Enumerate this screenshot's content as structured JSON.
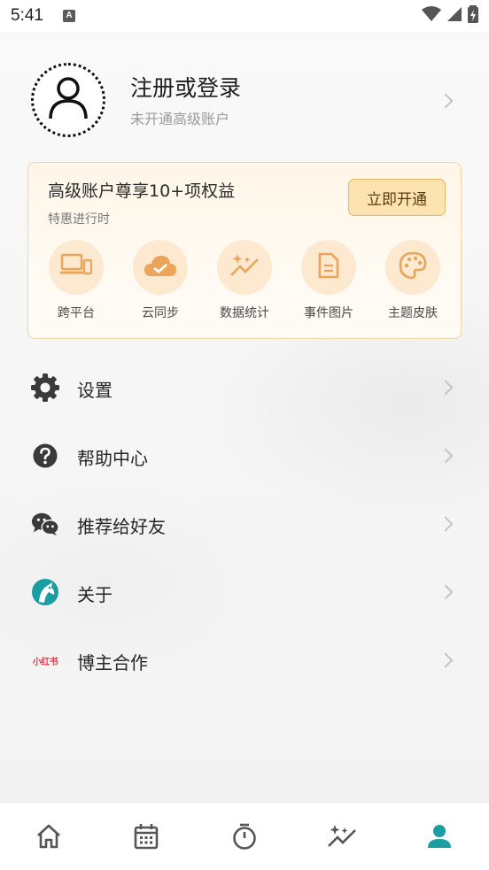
{
  "status_bar": {
    "time": "5:41",
    "indicator": "A"
  },
  "profile": {
    "name": "注册或登录",
    "subtitle": "未开通高级账户"
  },
  "premium": {
    "title": "高级账户尊享10+项权益",
    "subtitle": "特惠进行时",
    "button_label": "立即开通",
    "features": [
      {
        "label": "跨平台",
        "icon": "devices-icon"
      },
      {
        "label": "云同步",
        "icon": "cloud-check-icon"
      },
      {
        "label": "数据统计",
        "icon": "sparkle-chart-icon"
      },
      {
        "label": "事件图片",
        "icon": "document-icon"
      },
      {
        "label": "主题皮肤",
        "icon": "palette-icon"
      }
    ]
  },
  "menu": [
    {
      "label": "设置",
      "icon": "gear-icon"
    },
    {
      "label": "帮助中心",
      "icon": "help-icon"
    },
    {
      "label": "推荐给好友",
      "icon": "wechat-icon"
    },
    {
      "label": "关于",
      "icon": "app-logo-icon"
    },
    {
      "label": "博主合作",
      "icon": "xiaohongshu-icon",
      "icon_text": "小红书"
    }
  ],
  "bottom_nav": [
    {
      "name": "home",
      "icon": "home-icon",
      "active": false
    },
    {
      "name": "calendar",
      "icon": "calendar-icon",
      "active": false
    },
    {
      "name": "timer",
      "icon": "stopwatch-icon",
      "active": false
    },
    {
      "name": "stats",
      "icon": "sparkle-chart-icon",
      "active": false
    },
    {
      "name": "profile",
      "icon": "person-icon",
      "active": true
    }
  ],
  "colors": {
    "accent": "#1a9ea3",
    "card_border": "#f3d6a4",
    "feature_icon": "#eaa55a",
    "brand_red": "#e8384c"
  }
}
